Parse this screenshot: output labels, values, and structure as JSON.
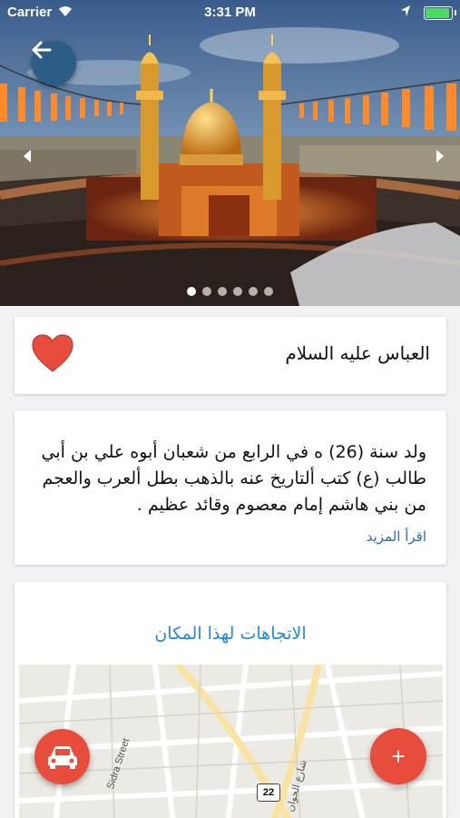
{
  "status_bar": {
    "carrier": "Carrier",
    "time": "3:31 PM",
    "battery_level": 1.0
  },
  "header": {
    "back_icon": "arrow-left-icon",
    "carousel": {
      "slide_count": 6,
      "active_index": 0,
      "prev_icon": "triangle-left-icon",
      "next_icon": "triangle-right-icon"
    }
  },
  "place": {
    "title": "العباس عليه السلام",
    "favorite_icon": "heart-icon",
    "favorite_color": "#e74c3c",
    "description": "ولد سنة (26) ه في الرابع من شعبان أبوه علي بن أبي طالب (ع) كتب ألتاريخ عنه بالذهب بطل ألعرب والعجم من بني هاشم إمام معصوم وقائد عظيم .",
    "read_more": "اقرأ المزيد"
  },
  "directions": {
    "label": "الاتجاهات لهذا المكان",
    "map_labels": {
      "street_a": "Sidra Street",
      "road_number": "22",
      "street_b": "شارع الجوان"
    }
  },
  "fabs": {
    "car_icon": "car-icon",
    "add_label": "+"
  },
  "colors": {
    "accent_blue": "#2686d9",
    "back_button": "#2c5d86",
    "fab": "#e74c3c"
  }
}
